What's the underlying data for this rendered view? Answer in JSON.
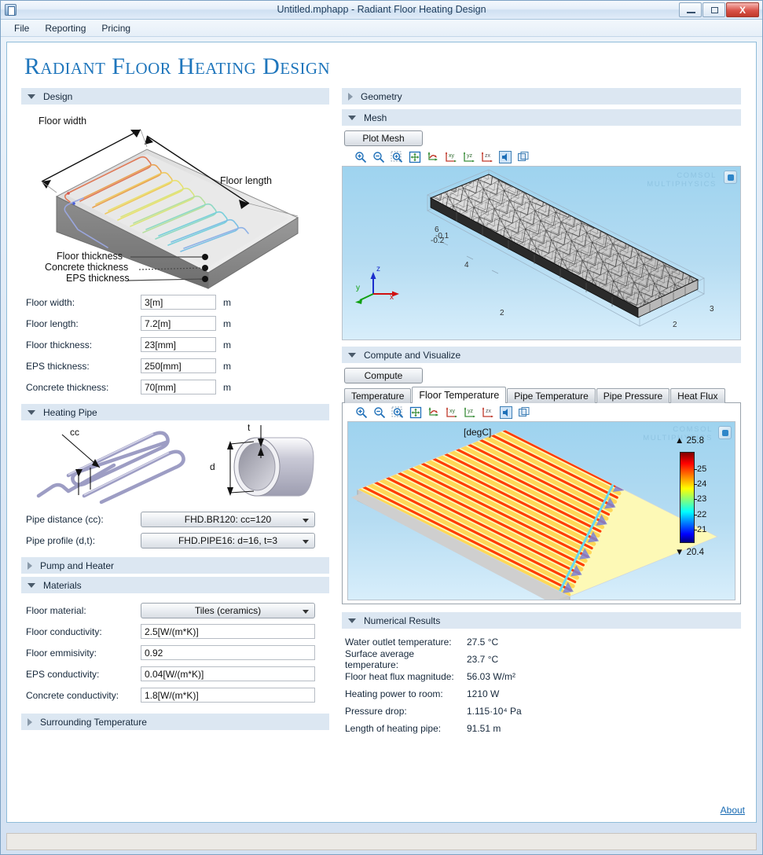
{
  "window": {
    "title": "Untitled.mphapp - Radiant Floor Heating Design",
    "icon": "app-icon",
    "minimize_label": "",
    "restore_label": "",
    "close_label": "X"
  },
  "menubar": {
    "items": [
      "File",
      "Reporting",
      "Pricing"
    ]
  },
  "app": {
    "title": "Radiant Floor Heating Design",
    "about_label": "About"
  },
  "left": {
    "design": {
      "header": "Design",
      "expanded": true,
      "diagram": {
        "floor_width_label": "Floor width",
        "floor_length_label": "Floor length",
        "floor_thickness_label": "Floor thickness",
        "concrete_thickness_label": "Concrete thickness",
        "eps_thickness_label": "EPS thickness"
      },
      "fields": [
        {
          "label": "Floor width:",
          "value": "3[m]",
          "unit": "m"
        },
        {
          "label": "Floor length:",
          "value": "7.2[m]",
          "unit": "m"
        },
        {
          "label": "Floor thickness:",
          "value": "23[mm]",
          "unit": "m"
        },
        {
          "label": "EPS thickness:",
          "value": "250[mm]",
          "unit": "m"
        },
        {
          "label": "Concrete thickness:",
          "value": "70[mm]",
          "unit": "m"
        }
      ]
    },
    "heating_pipe": {
      "header": "Heating Pipe",
      "expanded": true,
      "diagram": {
        "cc_label": "cc",
        "d_label": "d",
        "t_label": "t"
      },
      "fields": [
        {
          "label": "Pipe distance (cc):",
          "value": "FHD.BR120: cc=120"
        },
        {
          "label": "Pipe profile (d,t):",
          "value": "FHD.PIPE16: d=16, t=3"
        }
      ]
    },
    "pump_and_heater": {
      "header": "Pump and Heater",
      "expanded": false
    },
    "materials": {
      "header": "Materials",
      "expanded": true,
      "material_select": {
        "label": "Floor material:",
        "value": "Tiles (ceramics)"
      },
      "fields": [
        {
          "label": "Floor conductivity:",
          "value": "2.5[W/(m*K)]"
        },
        {
          "label": "Floor emmisivity:",
          "value": "0.92"
        },
        {
          "label": "EPS conductivity:",
          "value": "0.04[W/(m*K)]"
        },
        {
          "label": "Concrete conductivity:",
          "value": "1.8[W/(m*K)]"
        }
      ]
    },
    "surrounding_temperature": {
      "header": "Surrounding Temperature",
      "expanded": false
    }
  },
  "right": {
    "geometry": {
      "header": "Geometry",
      "expanded": false
    },
    "mesh": {
      "header": "Mesh",
      "expanded": true,
      "plot_button": "Plot Mesh",
      "watermark_line1": "COMSOL",
      "watermark_line2": "MULTIPHYSICS",
      "axis_labels": {
        "x": "x",
        "y": "y",
        "z": "z"
      },
      "y_ticks": [
        "6",
        "4",
        "2"
      ],
      "x_ticks": [
        "2",
        "3"
      ],
      "z_ticks": [
        "-0.1",
        "-0.2"
      ]
    },
    "compute": {
      "header": "Compute and Visualize",
      "expanded": true,
      "compute_button": "Compute",
      "tabs": [
        {
          "label": "Temperature",
          "active": false
        },
        {
          "label": "Floor Temperature",
          "active": true
        },
        {
          "label": "Pipe Temperature",
          "active": false
        },
        {
          "label": "Pipe Pressure",
          "active": false
        },
        {
          "label": "Heat Flux",
          "active": false
        }
      ],
      "plot": {
        "unit_label": "[degC]",
        "watermark_line1": "COMSOL",
        "watermark_line2": "MULTIPHYSICS",
        "max_marker": "▲ 25.8",
        "min_marker": "▼ 20.4",
        "legend_ticks": [
          "25",
          "24",
          "23",
          "22",
          "21"
        ]
      }
    },
    "numerical_results": {
      "header": "Numerical Results",
      "expanded": true,
      "rows": [
        {
          "label": "Water outlet temperature:",
          "value": "27.5 °C"
        },
        {
          "label": "Surface average temperature:",
          "value": "23.7 °C"
        },
        {
          "label": "Floor heat flux magnitude:",
          "value": "56.03 W/m²"
        },
        {
          "label": "Heating power to room:",
          "value": "1210 W"
        },
        {
          "label": "Pressure drop:",
          "value": "1.115·10⁴ Pa"
        },
        {
          "label": "Length of heating pipe:",
          "value": "91.51 m"
        }
      ]
    }
  },
  "toolbar_icons": [
    "zoom-in-icon",
    "zoom-out-icon",
    "zoom-box-icon",
    "zoom-extents-icon",
    "orbit-icon",
    "view-xy-icon",
    "view-yz-icon",
    "view-zx-icon",
    "scene-light-icon",
    "transparency-icon"
  ],
  "colors": {
    "title_blue": "#1f76bc",
    "section_header": "#dce7f2",
    "link_blue": "#1669b2",
    "close_red": "#c0392b"
  },
  "chart_data": {
    "type": "heatmap",
    "title": "Floor Temperature",
    "unit": "[degC]",
    "colorbar_min": 20.4,
    "colorbar_max": 25.8,
    "colorbar_ticks": [
      21,
      22,
      23,
      24,
      25
    ],
    "colormap": "jet",
    "description": "Surface temperature distribution over radiant floor with serpentine heating pipe",
    "results": {
      "water_outlet_temperature_C": 27.5,
      "surface_average_temperature_C": 23.7,
      "floor_heat_flux_W_per_m2": 56.03,
      "heating_power_W": 1210,
      "pressure_drop_Pa": 11150,
      "pipe_length_m": 91.51
    }
  }
}
